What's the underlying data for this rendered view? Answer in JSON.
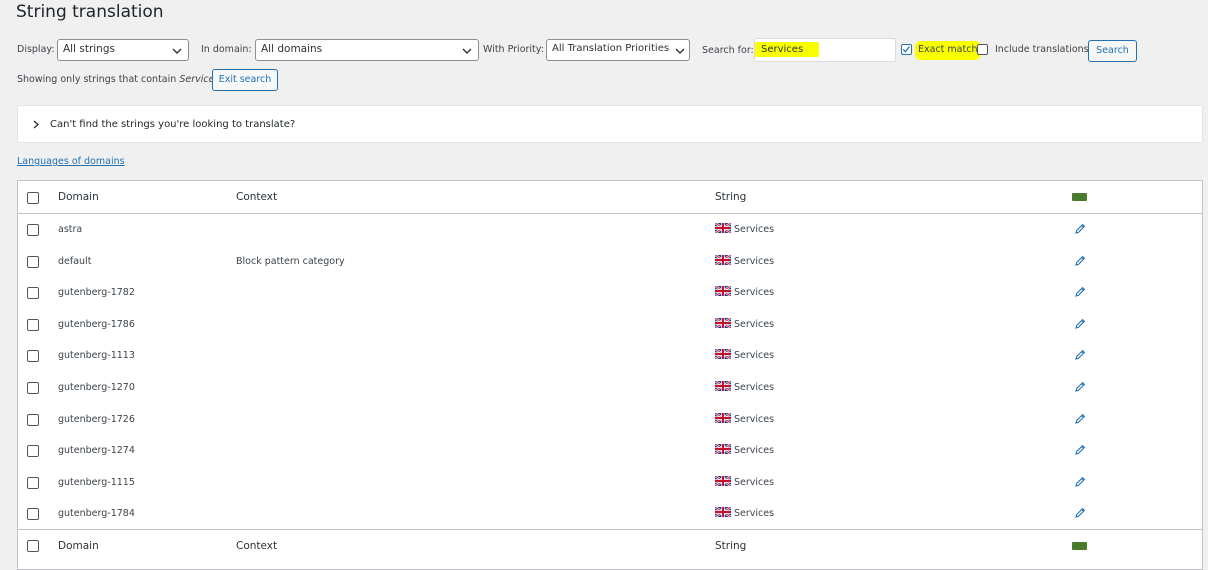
{
  "page": {
    "title": "String translation"
  },
  "filters": {
    "display_label": "Display:",
    "display_value": "All strings",
    "domain_label": "In domain:",
    "domain_value": "All domains",
    "priority_label": "With Priority:",
    "priority_value": "All Translation Priorities",
    "search_label": "Search for:",
    "search_value": "Services",
    "exact_match_label": "Exact match",
    "include_translations_label": "Include translations",
    "search_button": "Search"
  },
  "search_info": {
    "text": "Showing only strings that contain",
    "term": "Services",
    "exit_button": "Exit search"
  },
  "help_panel": {
    "text": "Can't find the strings you're looking to translate?"
  },
  "languages_link": "Languages of domains",
  "table": {
    "headers": {
      "domain": "Domain",
      "context": "Context",
      "string": "String"
    },
    "rows": [
      {
        "domain": "astra",
        "context": "",
        "string": "Services"
      },
      {
        "domain": "default",
        "context": "Block pattern category",
        "string": "Services"
      },
      {
        "domain": "gutenberg-1782",
        "context": "",
        "string": "Services"
      },
      {
        "domain": "gutenberg-1786",
        "context": "",
        "string": "Services"
      },
      {
        "domain": "gutenberg-1113",
        "context": "",
        "string": "Services"
      },
      {
        "domain": "gutenberg-1270",
        "context": "",
        "string": "Services"
      },
      {
        "domain": "gutenberg-1726",
        "context": "",
        "string": "Services"
      },
      {
        "domain": "gutenberg-1274",
        "context": "",
        "string": "Services"
      },
      {
        "domain": "gutenberg-1115",
        "context": "",
        "string": "Services"
      },
      {
        "domain": "gutenberg-1784",
        "context": "",
        "string": "Services"
      }
    ]
  },
  "icons": {
    "flag": "uk-flag-icon",
    "edit": "pencil-icon",
    "lang": "language-flag-icon"
  },
  "colors": {
    "accent": "#2271b1",
    "highlight": "#faff00",
    "lang_badge": "#4a7a2c"
  }
}
